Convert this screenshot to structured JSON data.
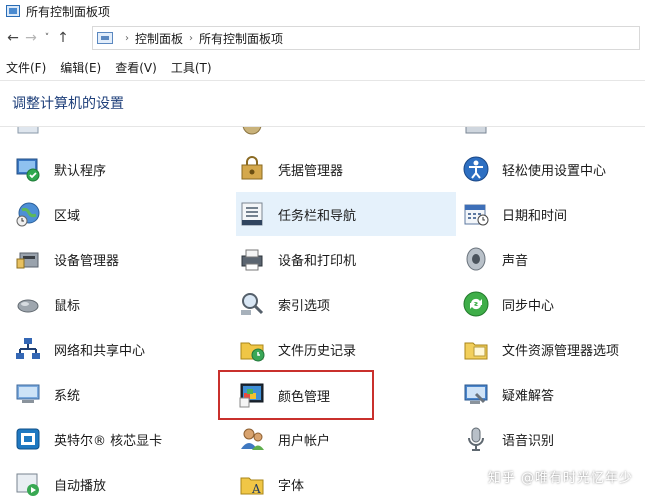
{
  "window": {
    "title": "所有控制面板项"
  },
  "nav": {
    "back": "←",
    "forward": "→",
    "recent": "˅",
    "up": "↑",
    "breadcrumbs": [
      "控制面板",
      "所有控制面板项"
    ],
    "separator": "›"
  },
  "menu": [
    "文件(F)",
    "编辑(E)",
    "查看(V)",
    "工具(T)"
  ],
  "heading": "调整计算机的设置",
  "items": {
    "col1": [
      "默认程序",
      "区域",
      "设备管理器",
      "鼠标",
      "网络和共享中心",
      "系统",
      "英特尔® 核芯显卡",
      "自动播放"
    ],
    "col2": [
      "凭据管理器",
      "任务栏和导航",
      "设备和打印机",
      "索引选项",
      "文件历史记录",
      "颜色管理",
      "用户帐户",
      "字体"
    ],
    "col3": [
      "轻松使用设置中心",
      "日期和时间",
      "声音",
      "同步中心",
      "文件资源管理器选项",
      "疑难解答",
      "语音识别"
    ]
  },
  "watermark": "知乎 @唯有时光忆年少",
  "colors": {
    "highlight": "#e5f1fb",
    "frame": "#c9302c",
    "heading": "#1e3f7a"
  }
}
